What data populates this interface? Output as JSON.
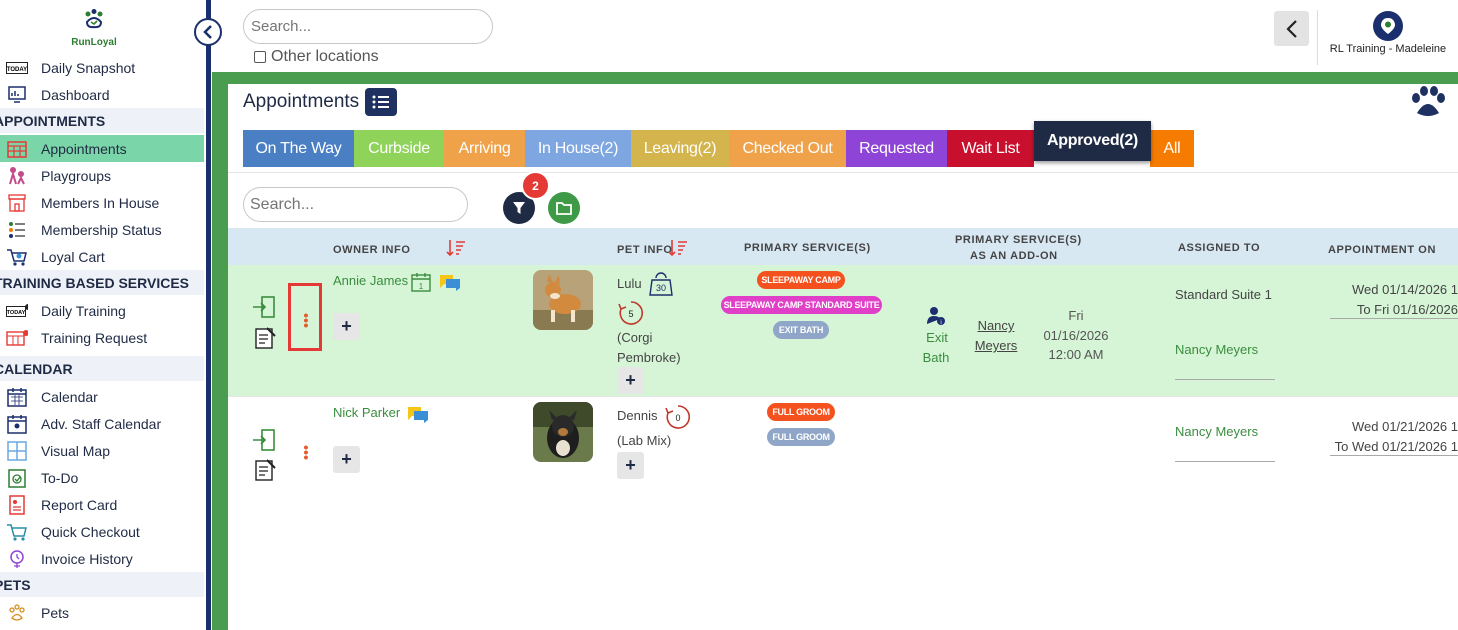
{
  "sidebar": {
    "brand": "RunLoyal",
    "items_top": [
      {
        "label": "Daily Snapshot",
        "icon": "today-icon"
      },
      {
        "label": "Dashboard",
        "icon": "dashboard-icon"
      }
    ],
    "sections": [
      {
        "title": "APPOINTMENTS",
        "items": [
          {
            "label": "Appointments",
            "icon": "calendar-grid-icon",
            "active": true
          },
          {
            "label": "Playgroups",
            "icon": "playgroups-icon"
          },
          {
            "label": "Members In House",
            "icon": "house-icon"
          },
          {
            "label": "Membership Status",
            "icon": "membership-list-icon"
          },
          {
            "label": "Loyal Cart",
            "icon": "cart-icon"
          }
        ]
      },
      {
        "title": "TRAINING BASED SERVICES",
        "items": [
          {
            "label": "Daily Training",
            "icon": "today-whistle-icon"
          },
          {
            "label": "Training Request",
            "icon": "training-request-icon"
          }
        ]
      },
      {
        "title": "CALENDAR",
        "items": [
          {
            "label": "Calendar",
            "icon": "calendar-icon"
          },
          {
            "label": "Adv. Staff Calendar",
            "icon": "staff-calendar-icon"
          },
          {
            "label": "Visual Map",
            "icon": "map-icon"
          },
          {
            "label": "To-Do",
            "icon": "todo-icon"
          },
          {
            "label": "Report Card",
            "icon": "report-card-icon"
          },
          {
            "label": "Quick Checkout",
            "icon": "quick-checkout-icon"
          },
          {
            "label": "Invoice History",
            "icon": "invoice-history-icon"
          }
        ]
      },
      {
        "title": "PETS",
        "items": [
          {
            "label": "Pets",
            "icon": "paw-icon"
          }
        ]
      }
    ]
  },
  "header": {
    "search_placeholder": "Search...",
    "other_locations_label": "Other locations",
    "user_name": "RL Training - Madeleine"
  },
  "page": {
    "title": "Appointments",
    "tabs": [
      {
        "label": "On The Way",
        "color": "#4a7fc4"
      },
      {
        "label": "Curbside",
        "color": "#8fd35a"
      },
      {
        "label": "Arriving",
        "color": "#f0a24a"
      },
      {
        "label": "In House(2)",
        "color": "#7ea6e0"
      },
      {
        "label": "Leaving(2)",
        "color": "#d4b44c"
      },
      {
        "label": "Checked Out",
        "color": "#f0a24a"
      },
      {
        "label": "Requested",
        "color": "#8e44d6"
      },
      {
        "label": "Wait List",
        "color": "#c8102e"
      },
      {
        "label": "Approved(2)",
        "color": "#1f2a44",
        "selected": true
      },
      {
        "label": "All",
        "color": "#f57c00"
      }
    ],
    "list_search_placeholder": "Search...",
    "filter_count": "2"
  },
  "table": {
    "headers": {
      "owner": "OWNER INFO",
      "pet": "PET INFO",
      "primary": "PRIMARY SERVICE(S)",
      "addon_line1": "PRIMARY SERVICE(S)",
      "addon_line2": "AS AN ADD-ON",
      "assigned": "ASSIGNED TO",
      "appointment": "APPOINTMENT ON"
    },
    "rows": [
      {
        "owner": "Annie James",
        "calendar_badge": "1",
        "pet_name": "Lulu",
        "weight": "30",
        "visits": "5",
        "breed_line1": "(Corgi",
        "breed_line2": "Pembroke)",
        "services": [
          {
            "label": "SLEEPAWAY CAMP",
            "color": "#f4511e"
          },
          {
            "label": "SLEEPAWAY CAMP STANDARD SUITE",
            "color": "#e040c8"
          },
          {
            "label": "EXIT BATH",
            "color": "#8fa6c8"
          }
        ],
        "addon": {
          "label_line1": "Exit",
          "label_line2": "Bath",
          "staff_line1": "Nancy",
          "staff_line2": "Meyers",
          "day": "Fri",
          "date": "01/16/2026",
          "time": "12:00 AM"
        },
        "assigned_room": "Standard Suite 1",
        "assigned_staff": "Nancy Meyers",
        "appt_line1": "Wed 01/14/2026 1",
        "appt_line2": "To Fri 01/16/2026"
      },
      {
        "owner": "Nick Parker",
        "pet_name": "Dennis",
        "visits": "0",
        "breed_line1": "(Lab Mix)",
        "services": [
          {
            "label": "FULL GROOM",
            "color": "#f4511e"
          },
          {
            "label": "FULL GROOM",
            "color": "#8fa6c8"
          }
        ],
        "assigned_staff": "Nancy Meyers",
        "appt_line1": "Wed 01/21/2026 1",
        "appt_line2": "To Wed 01/21/2026 1"
      }
    ]
  }
}
